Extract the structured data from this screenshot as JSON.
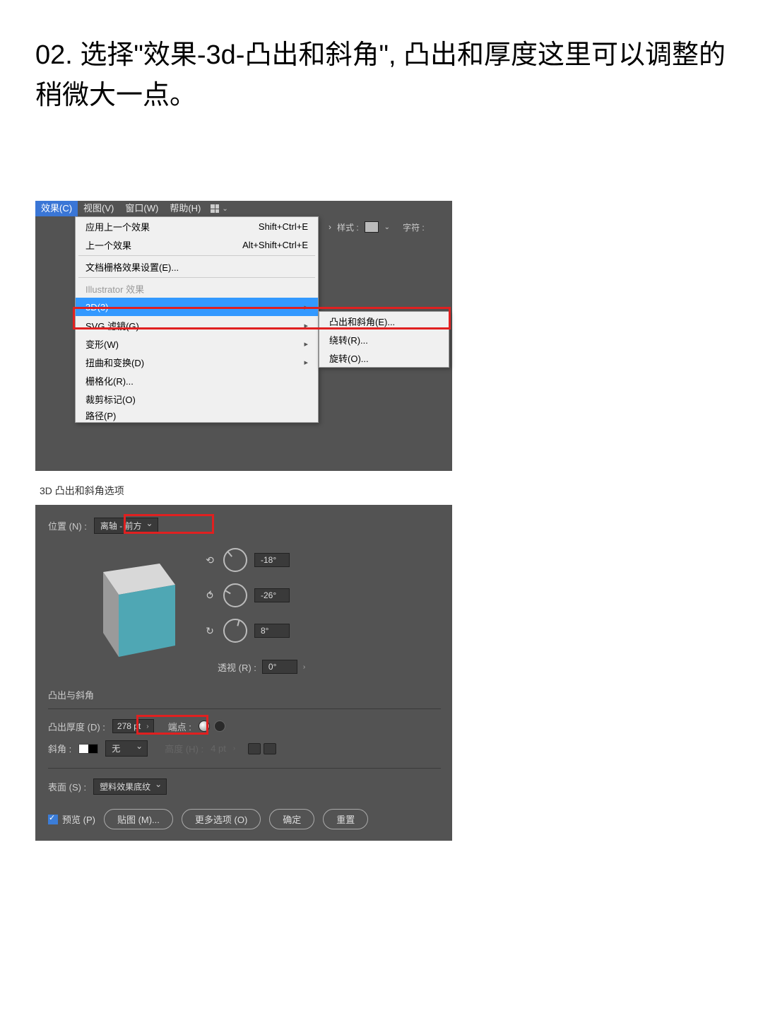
{
  "title": "02.  选择\"效果-3d-凸出和斜角\", 凸出和厚度这里可以调整的稍微大一点。",
  "menubar": {
    "effect": "效果(C)",
    "view": "视图(V)",
    "window": "窗口(W)",
    "help": "帮助(H)"
  },
  "toolbar": {
    "style_label": "样式 :",
    "char_label": "字符 :"
  },
  "menu": {
    "apply_last": "应用上一个效果",
    "apply_last_key": "Shift+Ctrl+E",
    "last": "上一个效果",
    "last_key": "Alt+Shift+Ctrl+E",
    "doc_raster": "文档栅格效果设置(E)...",
    "section": "Illustrator 效果",
    "threeD": "3D(3)",
    "svg": "SVG 滤镜(G)",
    "warp": "变形(W)",
    "distort": "扭曲和变换(D)",
    "rasterize": "栅格化(R)...",
    "crop": "裁剪标记(O)",
    "path": "路径(P)"
  },
  "submenu": {
    "extrude": "凸出和斜角(E)...",
    "revolve": "绕转(R)...",
    "rotate": "旋转(O)..."
  },
  "dialog": {
    "title": "3D 凸出和斜角选项",
    "position_label": "位置 (N) :",
    "position_value": "离轴 - 前方",
    "angle_x": "-18°",
    "angle_y": "-26°",
    "angle_z": "8°",
    "perspective_label": "透视 (R) :",
    "perspective_value": "0°",
    "section_extrude": "凸出与斜角",
    "depth_label": "凸出厚度 (D) :",
    "depth_value": "278 pt",
    "cap_label": "端点 :",
    "bevel_label": "斜角 :",
    "bevel_value": "无",
    "height_label": "高度 (H) :",
    "height_value": "4 pt",
    "surface_label": "表面 (S) :",
    "surface_value": "塑料效果底纹",
    "preview": "预览 (P)",
    "map_art": "贴图 (M)...",
    "more_options": "更多选项 (O)",
    "ok": "确定",
    "reset": "重置"
  }
}
